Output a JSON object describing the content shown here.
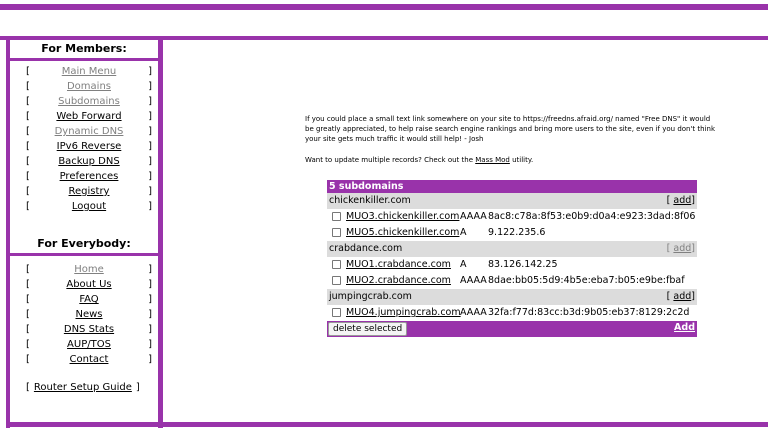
{
  "sidebar": {
    "members_heading": "For Members:",
    "members_items": [
      {
        "label": "Main Menu",
        "state": "dim"
      },
      {
        "label": "Domains",
        "state": "dim"
      },
      {
        "label": "Subdomains",
        "state": "dim"
      },
      {
        "label": "Web Forward",
        "state": "active"
      },
      {
        "label": "Dynamic DNS",
        "state": "dim"
      },
      {
        "label": "IPv6 Reverse",
        "state": "active"
      },
      {
        "label": "Backup DNS",
        "state": "active"
      },
      {
        "label": "Preferences",
        "state": "active"
      },
      {
        "label": "Registry",
        "state": "active"
      },
      {
        "label": "Logout",
        "state": "active"
      }
    ],
    "everybody_heading": "For Everybody:",
    "everybody_items": [
      {
        "label": "Home",
        "state": "dim"
      },
      {
        "label": "About Us",
        "state": "active"
      },
      {
        "label": "FAQ",
        "state": "active"
      },
      {
        "label": "News",
        "state": "active"
      },
      {
        "label": "DNS Stats",
        "state": "active"
      },
      {
        "label": "AUP/TOS",
        "state": "active"
      },
      {
        "label": "Contact",
        "state": "active"
      }
    ],
    "router_guide": "Router Setup Guide",
    "bracket_open": "[",
    "bracket_close": "]"
  },
  "main": {
    "notice": "If you could place a small text link somewhere on your site to https://freedns.afraid.org/ named \"Free DNS\" it would be greatly appreciated, to help raise search engine rankings and bring more users to the site, even if you don't think your site gets much traffic it would still help! - Josh",
    "massmod_prefix": "Want to update multiple records? Check out the ",
    "massmod_link": "Mass Mod",
    "massmod_suffix": " utility."
  },
  "table": {
    "header": "5 subdomains",
    "add_label": "add",
    "delete_button": "delete selected",
    "footer_add": "Add",
    "groups": [
      {
        "domain": "chickenkiller.com",
        "add_state": "active",
        "rows": [
          {
            "host": "MUO3.chickenkiller.com",
            "type": "AAAA",
            "value": "8ac8:c78a:8f53:e0b9:d0a4:e923:3dad:8f06"
          },
          {
            "host": "MUO5.chickenkiller.com",
            "type": "A",
            "value": "9.122.235.6"
          }
        ]
      },
      {
        "domain": "crabdance.com",
        "add_state": "dim",
        "rows": [
          {
            "host": "MUO1.crabdance.com",
            "type": "A",
            "value": "83.126.142.25"
          },
          {
            "host": "MUO2.crabdance.com",
            "type": "AAAA",
            "value": "8dae:bb05:5d9:4b5e:eba7:b05:e9be:fbaf"
          }
        ]
      },
      {
        "domain": "jumpingcrab.com",
        "add_state": "active",
        "rows": [
          {
            "host": "MUO4.jumpingcrab.com",
            "type": "AAAA",
            "value": "32fa:f77d:83cc:b3d:9b05:eb37:8129:2c2d"
          }
        ]
      }
    ]
  },
  "colors": {
    "accent": "#9933aa",
    "group_row": "#dcdcdc",
    "dim_link": "#808080"
  }
}
